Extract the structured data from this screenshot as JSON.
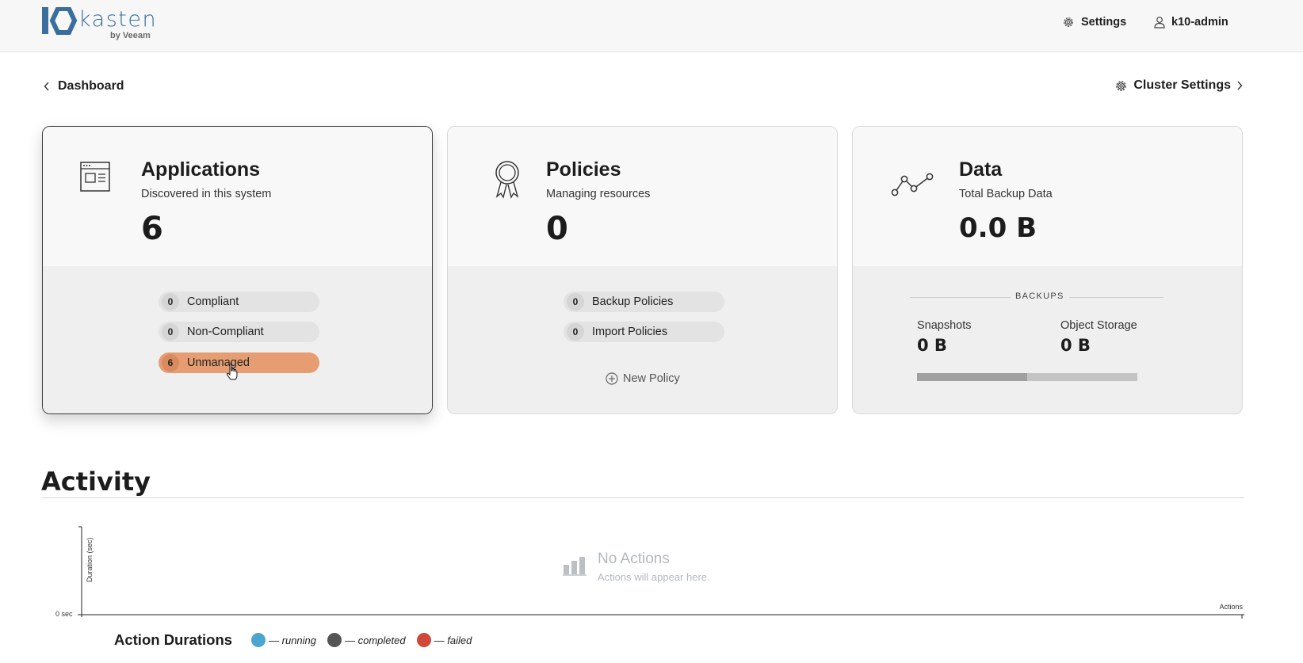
{
  "brand": {
    "wordmark": "kasten",
    "sub": "by Veeam",
    "color": "#3a6f9d"
  },
  "topbar": {
    "settings_label": "Settings",
    "user_label": "k10-admin"
  },
  "breadcrumb": {
    "label": "Dashboard"
  },
  "cluster_settings": {
    "label": "Cluster Settings"
  },
  "cards": {
    "applications": {
      "title": "Applications",
      "subtitle": "Discovered in this system",
      "count": "6",
      "pills": [
        {
          "count": "0",
          "label": "Compliant"
        },
        {
          "count": "0",
          "label": "Non-Compliant"
        },
        {
          "count": "6",
          "label": "Unmanaged",
          "color": "#e59d71"
        }
      ]
    },
    "policies": {
      "title": "Policies",
      "subtitle": "Managing resources",
      "count": "0",
      "pills": [
        {
          "count": "0",
          "label": "Backup Policies"
        },
        {
          "count": "0",
          "label": "Import Policies"
        }
      ],
      "new_policy_label": "New Policy"
    },
    "data": {
      "title": "Data",
      "subtitle": "Total Backup Data",
      "total": "0.0 B",
      "backups_label": "BACKUPS",
      "snapshots_label": "Snapshots",
      "snapshots_value": "0 B",
      "object_storage_label": "Object Storage",
      "object_storage_value": "0 B",
      "snapshot_share": 0.5
    }
  },
  "activity": {
    "title": "Activity",
    "y_axis_label": "Duration (sec)",
    "zero_label": "0 sec",
    "x_axis_label": "Actions",
    "empty_title": "No Actions",
    "empty_sub": "Actions will appear here.",
    "legend_title": "Action Durations",
    "legend": [
      {
        "label": "— running",
        "color": "#4aa6cf"
      },
      {
        "label": "— completed",
        "color": "#555555"
      },
      {
        "label": "— failed",
        "color": "#d0483a"
      }
    ]
  }
}
